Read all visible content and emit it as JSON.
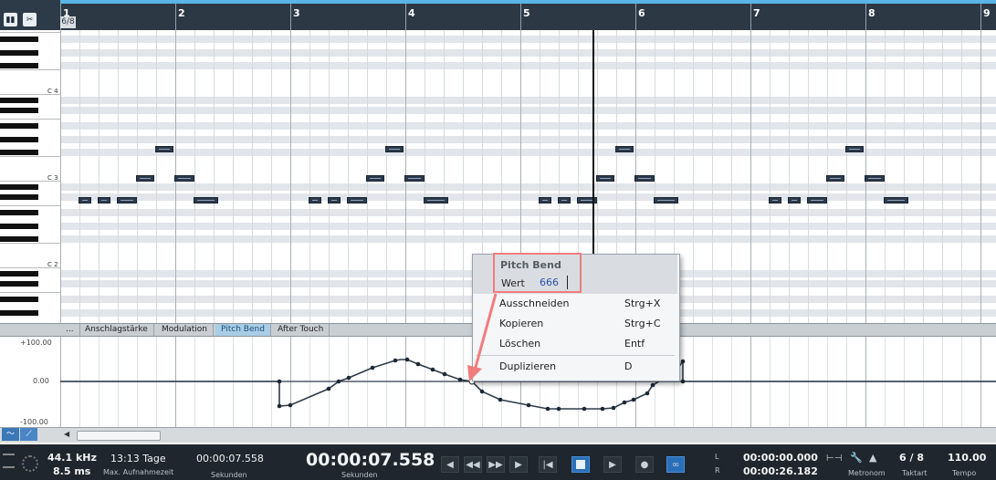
{
  "ruler": {
    "time_signature": "6/8",
    "bars": [
      "1",
      "2",
      "3",
      "4",
      "5",
      "6",
      "7",
      "8",
      "9"
    ]
  },
  "tools": {
    "left_tool_icon": "note-tool-icon",
    "right_tool_icon": "scissors-icon"
  },
  "piano": {
    "labels": [
      "C 4",
      "C 3",
      "C 2"
    ]
  },
  "lanes": {
    "tabs": [
      "...",
      "Anschlagstärke",
      "Modulation",
      "Pitch Bend",
      "After Touch"
    ],
    "active": "Pitch Bend",
    "y_labels": [
      "+100.00",
      "0.00",
      "-100.00"
    ]
  },
  "context_menu": {
    "title": "Pitch Bend",
    "value_label": "Wert",
    "value": "666",
    "items": [
      {
        "label": "Ausschneiden",
        "shortcut": "Strg+X"
      },
      {
        "label": "Kopieren",
        "shortcut": "Strg+C"
      },
      {
        "label": "Löschen",
        "shortcut": "Entf"
      },
      {
        "label": "Duplizieren",
        "shortcut": "D"
      }
    ]
  },
  "transport": {
    "sample_rate": "44.1 kHz",
    "latency": "8.5 ms",
    "record_days": "13:13 Tage",
    "record_label": "Max. Aufnahmezeit",
    "seconds_small": "00:00:07.558",
    "seconds_small_label": "Sekunden",
    "main_time": "00:00:07.558",
    "main_time_label": "Sekunden",
    "marker_l_letter": "L",
    "marker_r_letter": "R",
    "loop_start": "00:00:00.000",
    "loop_end": "00:00:26.182",
    "metronome_label": "Metronom",
    "taktart_value": "6 / 8",
    "taktart_label": "Taktart",
    "tempo_value": "110.00",
    "tempo_label": "Tempo"
  },
  "colors": {
    "accent": "#5ab4e6",
    "note": "#2c3a4c",
    "highlight_box": "#f07c7c",
    "transport_bg": "#1f262d",
    "active_tab": "#a9cde6"
  }
}
